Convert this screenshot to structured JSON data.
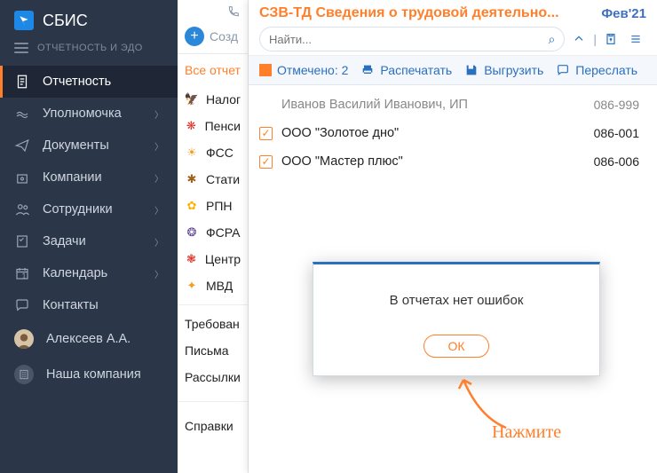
{
  "brand": "СБИС",
  "brand_sub": "ОТЧЕТНОСТЬ И ЭДО",
  "nav": [
    {
      "label": "Отчетность",
      "active": true,
      "chev": false,
      "icon": "doc"
    },
    {
      "label": "Уполномочка",
      "active": false,
      "chev": true,
      "icon": "hands"
    },
    {
      "label": "Документы",
      "active": false,
      "chev": true,
      "icon": "send"
    },
    {
      "label": "Компании",
      "active": false,
      "chev": true,
      "icon": "co"
    },
    {
      "label": "Сотрудники",
      "active": false,
      "chev": true,
      "icon": "people"
    },
    {
      "label": "Задачи",
      "active": false,
      "chev": true,
      "icon": "task"
    },
    {
      "label": "Календарь",
      "active": false,
      "chev": true,
      "icon": "cal"
    },
    {
      "label": "Контакты",
      "active": false,
      "chev": false,
      "icon": "chat"
    }
  ],
  "user_name": "Алексеев А.А.",
  "our_company": "Наша компания",
  "create_label": "Созд",
  "filter_active": "Все отчет",
  "categories": [
    {
      "label": "Налог",
      "icon": "🦅",
      "color": "#1f5fbf"
    },
    {
      "label": "Пенси",
      "icon": "❋",
      "color": "#d93025"
    },
    {
      "label": "ФСС",
      "icon": "☀",
      "color": "#f0a020"
    },
    {
      "label": "Стати",
      "icon": "✱",
      "color": "#a06020"
    },
    {
      "label": "РПН",
      "icon": "✿",
      "color": "#ffb000"
    },
    {
      "label": "ФСРА",
      "icon": "❂",
      "color": "#5a3e8f"
    },
    {
      "label": "Центр",
      "icon": "❃",
      "color": "#d93025"
    },
    {
      "label": "МВД",
      "icon": "✦",
      "color": "#f0a020"
    }
  ],
  "plain_categories": [
    "Требован",
    "Письма",
    "Рассылки",
    "Справки "
  ],
  "panel": {
    "title": "СЗВ-ТД Сведения о трудовой деятельно...",
    "date": "Фев'21",
    "search_placeholder": "Найти..."
  },
  "toolbar": {
    "marked": "Отмечено: 2",
    "print": "Распечатать",
    "export": "Выгрузить",
    "forward": "Переслать"
  },
  "rows": [
    {
      "checked": false,
      "gray": true,
      "name": "Иванов Василий Иванович, ИП",
      "code": "086-999"
    },
    {
      "checked": true,
      "gray": false,
      "name": "ООО \"Золотое дно\"",
      "code": "086-001"
    },
    {
      "checked": true,
      "gray": false,
      "name": "ООО \"Мастер плюс\"",
      "code": "086-006"
    }
  ],
  "modal": {
    "message": "В отчетах нет ошибок",
    "ok": "ОК"
  },
  "annotation": "Нажмите",
  "calendar_badge": "1"
}
